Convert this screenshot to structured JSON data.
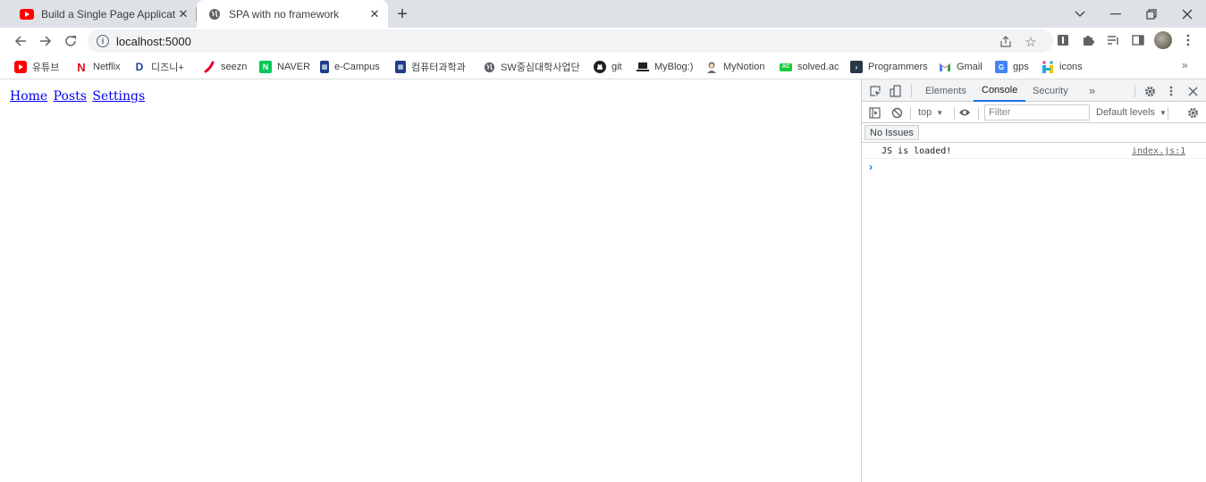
{
  "tabs": [
    {
      "title": "Build a Single Page Application",
      "icon": "youtube-icon",
      "active": false
    },
    {
      "title": "SPA with no framework",
      "icon": "globe-icon",
      "active": true
    }
  ],
  "address": {
    "url": "localhost:5000"
  },
  "bookmarks": [
    {
      "label": "유튜브",
      "icon": "youtube-icon",
      "color": "#ff0000"
    },
    {
      "label": "Netflix",
      "icon": "netflix-icon",
      "color": "#e50914"
    },
    {
      "label": "디즈니+",
      "icon": "disney-icon",
      "color": "#1c3fa8"
    },
    {
      "label": "seezn",
      "icon": "seezn-icon",
      "color": "#e6002d"
    },
    {
      "label": "NAVER",
      "icon": "naver-icon",
      "color": "#03c75a"
    },
    {
      "label": "e-Campus",
      "icon": "ecampus-icon",
      "color": "#1d3e8a"
    },
    {
      "label": "컴퓨터과학과",
      "icon": "school-icon",
      "color": "#1d3e8a"
    },
    {
      "label": "SW중심대학사업단",
      "icon": "globe-icon",
      "color": "#5f6368"
    },
    {
      "label": "git",
      "icon": "github-icon",
      "color": "#202124"
    },
    {
      "label": "MyBlog:)",
      "icon": "laptop-icon",
      "color": "#202124"
    },
    {
      "label": "MyNotion",
      "icon": "notion-icon",
      "color": "#5f6368"
    },
    {
      "label": "solved.ac",
      "icon": "solvedac-icon",
      "color": "#17ce3a"
    },
    {
      "label": "Programmers",
      "icon": "programmers-icon",
      "color": "#263747"
    },
    {
      "label": "Gmail",
      "icon": "gmail-icon",
      "color": "#ea4335"
    },
    {
      "label": "gps",
      "icon": "gps-icon",
      "color": "#4285f4"
    },
    {
      "label": "icons",
      "icon": "icons-icon",
      "color": "#26a8e0"
    }
  ],
  "page": {
    "nav": [
      {
        "label": "Home"
      },
      {
        "label": "Posts"
      },
      {
        "label": "Settings"
      }
    ]
  },
  "devtools": {
    "tabs": [
      "Elements",
      "Console",
      "Security"
    ],
    "active_tab": "Console",
    "context": "top",
    "filter_placeholder": "Filter",
    "levels": "Default levels",
    "issues": "No Issues",
    "logs": [
      {
        "message": "JS is loaded!",
        "source": "index.js:1"
      }
    ]
  },
  "colors": {
    "accent": "#1a73e8",
    "link": "#0000ee"
  }
}
